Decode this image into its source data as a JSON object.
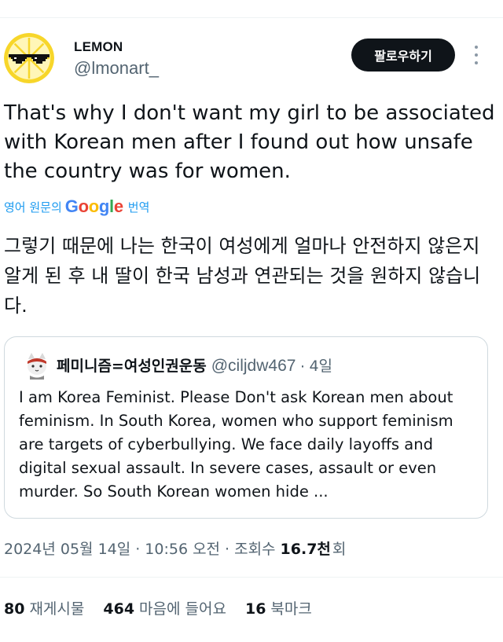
{
  "tweet": {
    "author_name": "LEMON",
    "author_handle": "@lmonart_",
    "follow_label": "팔로우하기",
    "text": "That's why I don't want my girl to be associated with Korean men after I found out how unsafe the country was for women.",
    "translate": {
      "prefix": "영어 원문의",
      "google": "Google",
      "suffix": "번역"
    },
    "translated_text": "그렇기 때문에 나는 한국이 여성에게 얼마나 안전하지 않은지 알게 된 후 내 딸이 한국 남성과 연관되는 것을 원하지 않습니다.",
    "quote": {
      "author_name": "페미니즘=여성인권운동",
      "author_handle": "@ciljdw467",
      "separator": "·",
      "time": "4일",
      "text": "I am Korea Feminist. Please Don't ask Korean men about feminism. In South Korea, women who support feminism are targets of cyberbullying. We face daily layoffs and digital sexual assault. In severe cases, assault or even murder. So South Korean women hide ..."
    },
    "meta": {
      "date": "2024년 05월 14일",
      "time": "10:56 오전",
      "views_prefix": "조회수",
      "views_count": "16.7천",
      "views_suffix": "회",
      "separator": "·"
    },
    "stats": [
      {
        "count": "80",
        "label": "재게시물"
      },
      {
        "count": "464",
        "label": "마음에 들어요"
      },
      {
        "count": "16",
        "label": "북마크"
      }
    ]
  },
  "icons": {
    "avatar": "lemon-sunglasses-avatar",
    "quote_avatar": "cat-avatar",
    "more": "more-dots-icon"
  },
  "colors": {
    "text_primary": "#0f1419",
    "text_secondary": "#536471",
    "link_blue": "#1d9bf0",
    "button_dark": "#0f1419",
    "border": "#cfd9de",
    "lemon_yellow": "#f7d62a"
  }
}
